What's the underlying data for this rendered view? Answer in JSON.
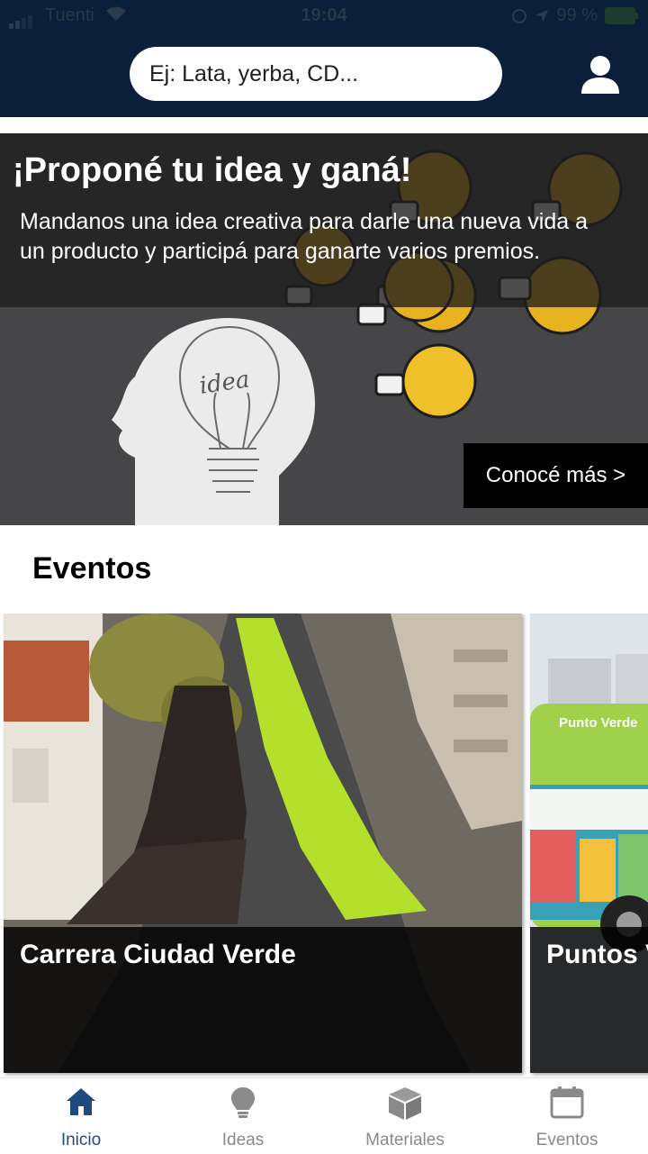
{
  "status_bar": {
    "carrier": "Tuenti",
    "time": "19:04",
    "battery": "99 %"
  },
  "search": {
    "placeholder": "Ej: Lata, yerba, CD..."
  },
  "banner": {
    "title": "¡Proponé tu idea y ganá!",
    "text": "Mandanos una idea creativa para darle una nueva vida a un producto y participá para ganarte varios premios.",
    "button_label": "Conocé más >",
    "bulb_word": "idea"
  },
  "events": {
    "title": "Eventos",
    "cards": [
      {
        "title": "Carrera Ciudad Verde"
      },
      {
        "title": "Puntos Verdes",
        "van_label": "Punto Verde"
      }
    ]
  },
  "nav": {
    "items": [
      {
        "label": "Inicio",
        "icon": "home-icon",
        "active": true
      },
      {
        "label": "Ideas",
        "icon": "lightbulb-icon",
        "active": false
      },
      {
        "label": "Materiales",
        "icon": "box-icon",
        "active": false
      },
      {
        "label": "Eventos",
        "icon": "calendar-icon",
        "active": false
      }
    ]
  },
  "colors": {
    "header_bg": "#0b1f3a",
    "active_nav": "#1e4a80",
    "inactive_nav": "#8a8a8a",
    "bulb_yellow": "#e8b21f"
  }
}
